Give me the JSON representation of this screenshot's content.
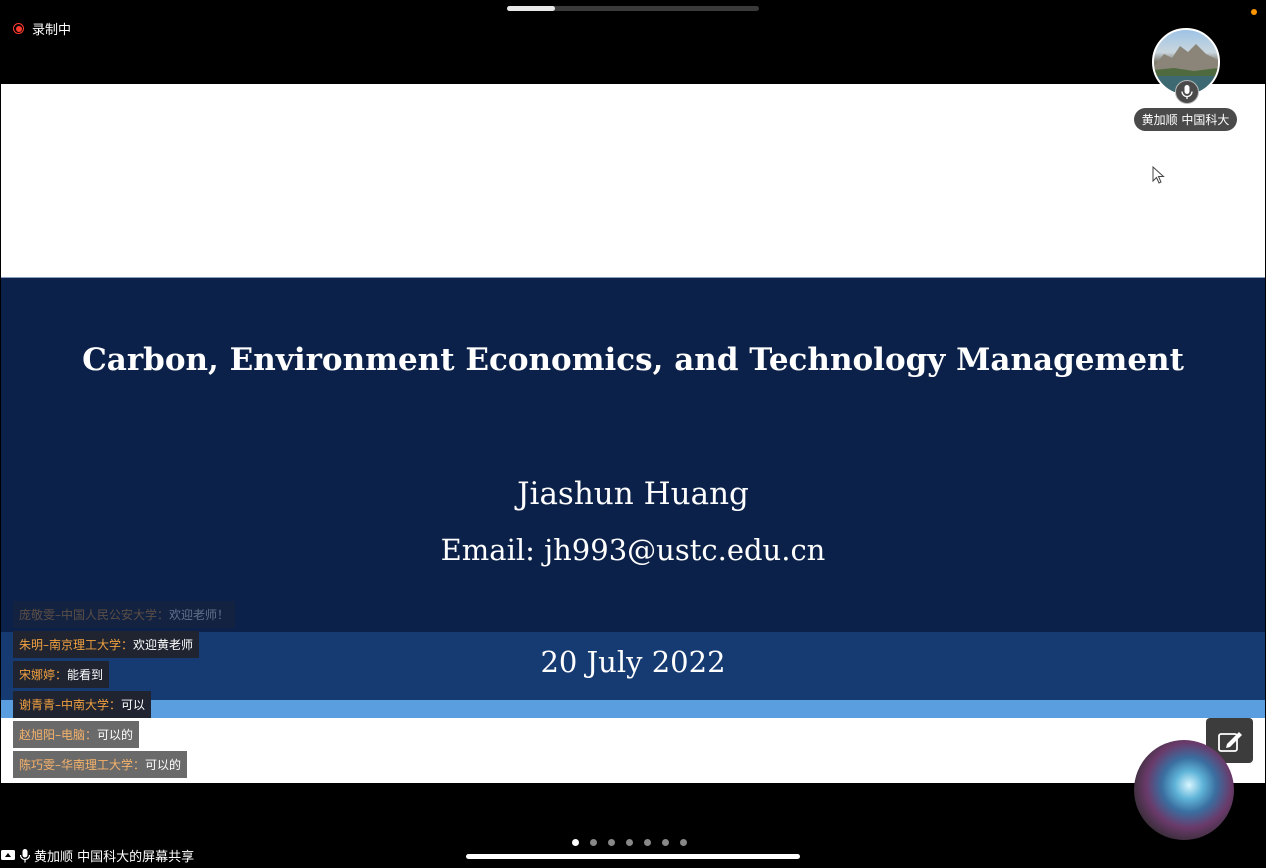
{
  "top": {
    "progress_fraction": 0.19
  },
  "recording": {
    "label": "录制中"
  },
  "participant": {
    "name": "黄加顺 中国科大",
    "avatar_icon": "landscape-avatar",
    "mic_icon": "mic-icon"
  },
  "slide": {
    "title": "Carbon, Environment Economics, and Technology Management",
    "author": "Jiashun Huang",
    "email": "Email: jh993@ustc.edu.cn",
    "date": "20 July 2022"
  },
  "chat": {
    "messages": [
      {
        "sender": "庞敬雯–中国人民公安大学：",
        "text": "欢迎老师！"
      },
      {
        "sender": "朱明–南京理工大学：",
        "text": "欢迎黄老师"
      },
      {
        "sender": "宋娜婷：",
        "text": "能看到"
      },
      {
        "sender": "谢青青–中南大学：",
        "text": "可以"
      },
      {
        "sender": "赵旭阳–电脑：",
        "text": "可以的"
      },
      {
        "sender": "陈巧雯–华南理工大学：",
        "text": "可以的"
      }
    ]
  },
  "bottom": {
    "share_label": "黄加顺 中国科大的屏幕共享",
    "page_count": 7,
    "active_page": 1
  },
  "colors": {
    "slide_band": "#0b2149",
    "date_band": "#163a72",
    "accent_band": "#5b9ee0",
    "recording": "#ff3b30",
    "sender": "#f0a040"
  }
}
